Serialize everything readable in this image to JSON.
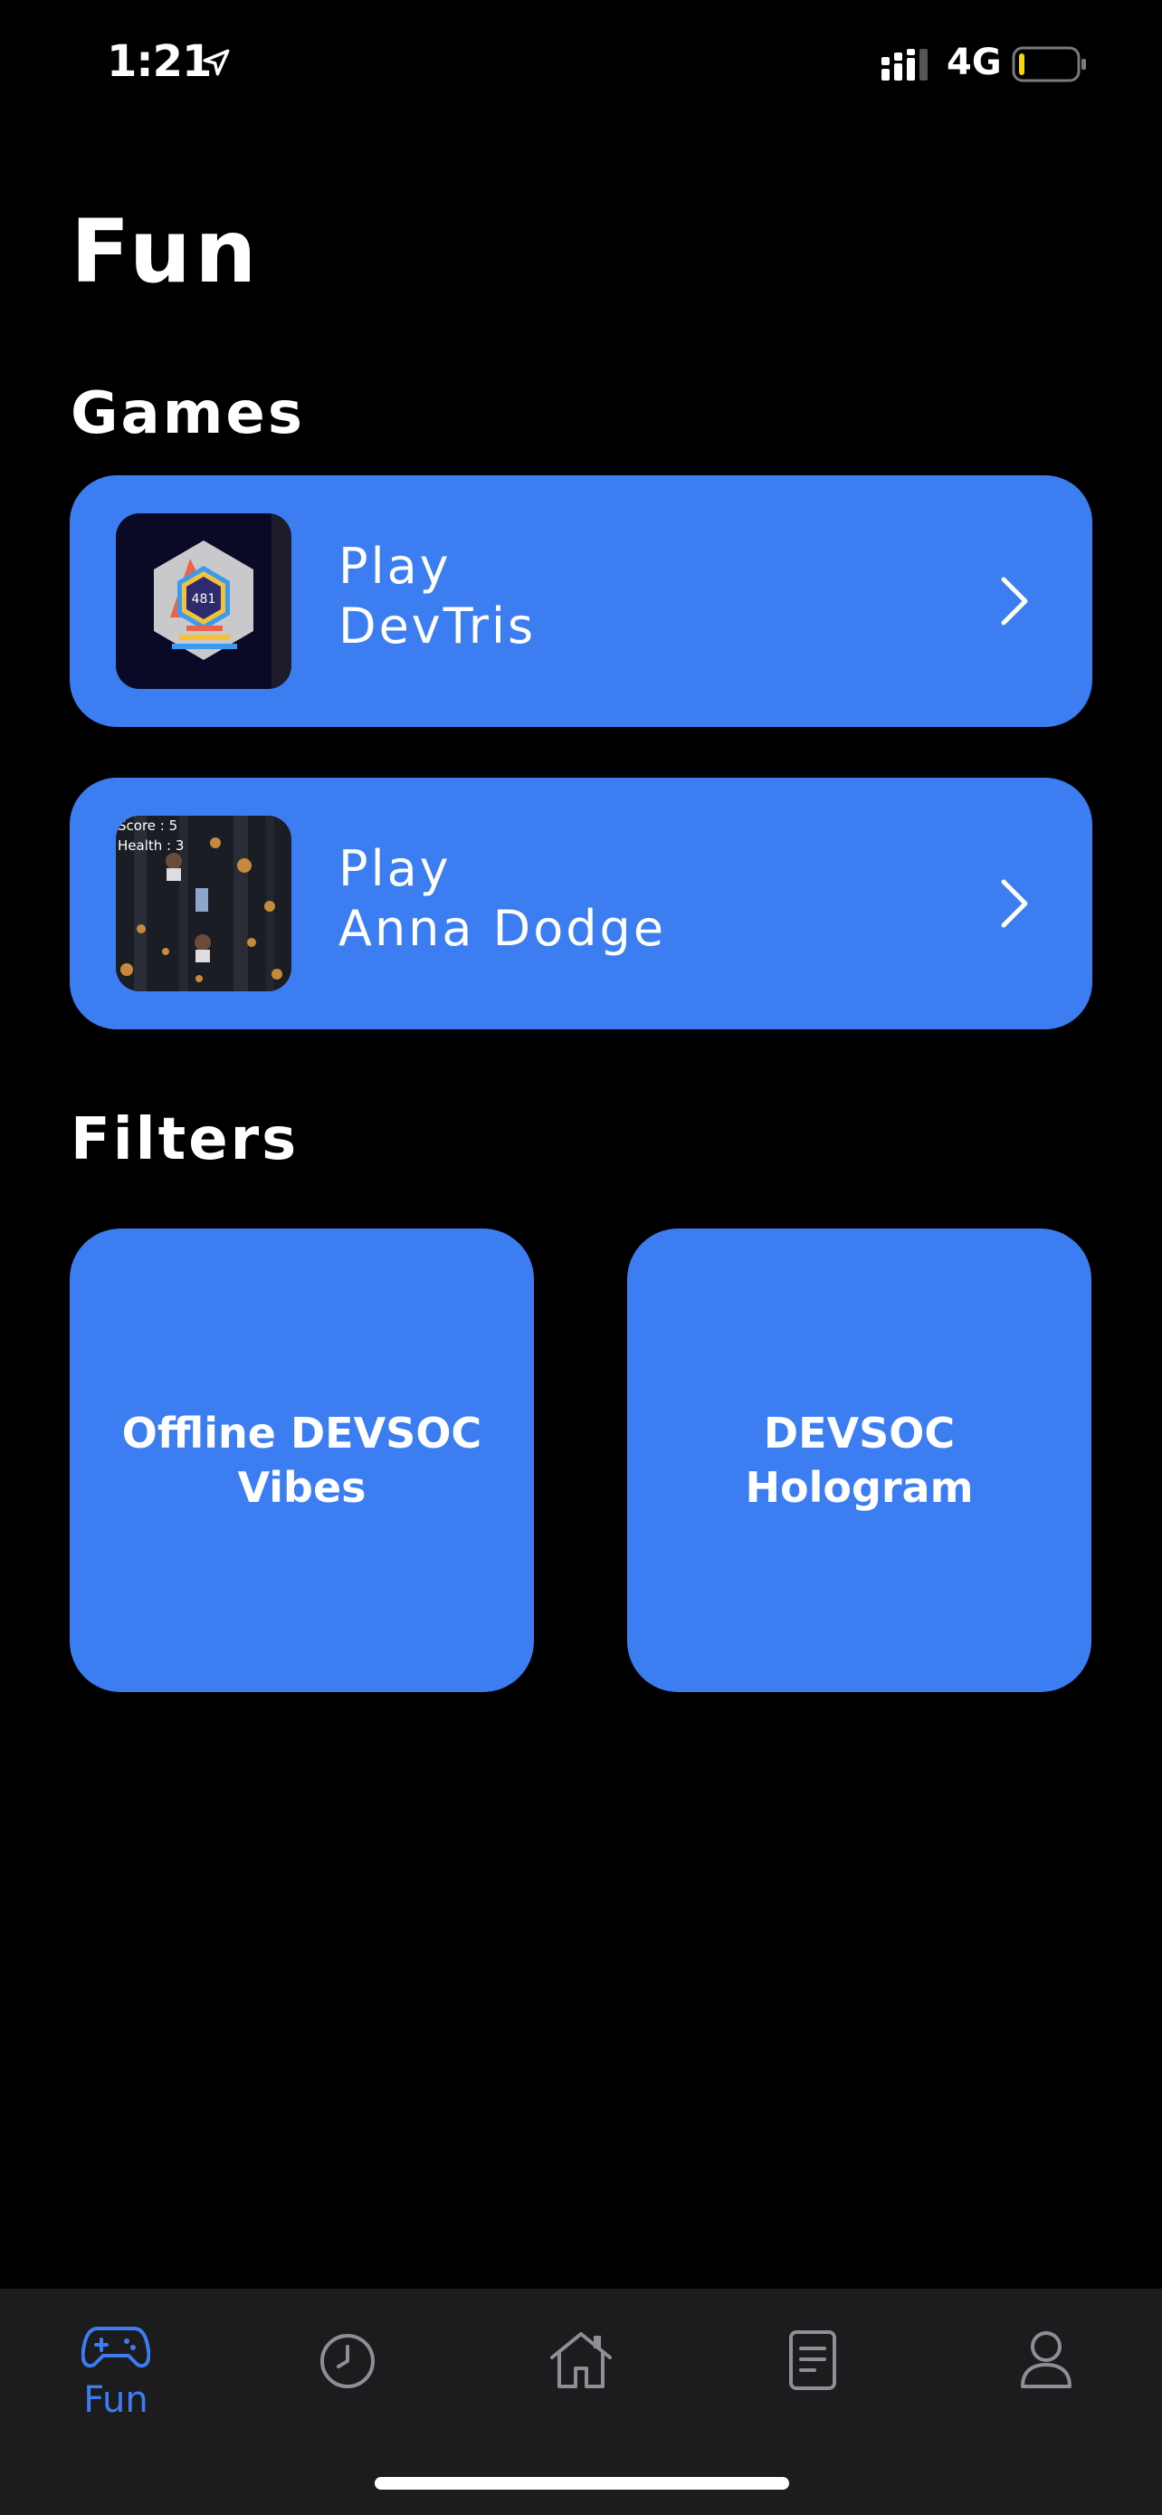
{
  "status_bar": {
    "time": "1:21",
    "network": "4G",
    "battery_color": "#f5d60a"
  },
  "page": {
    "title": "Fun"
  },
  "games_section": {
    "title": "Games",
    "items": [
      {
        "line1": "Play",
        "line2": "DevTris",
        "thumb_text": "481"
      },
      {
        "line1": "Play",
        "line2": "Anna Dodge",
        "thumb_text_1": "Score : 5",
        "thumb_text_2": "Health : 3"
      }
    ]
  },
  "filters_section": {
    "title": "Filters",
    "items": [
      {
        "label": "Offline DEVSOC Vibes"
      },
      {
        "label": "DEVSOC Hologram"
      }
    ]
  },
  "tab_bar": {
    "active_color": "#3c7ef2",
    "inactive_color": "#8e8e93",
    "items": [
      {
        "icon": "gamepad-icon",
        "label": "Fun"
      },
      {
        "icon": "clock-icon"
      },
      {
        "icon": "home-icon"
      },
      {
        "icon": "document-icon"
      },
      {
        "icon": "person-icon"
      }
    ]
  },
  "colors": {
    "card": "#3c7ef2",
    "background": "#000000"
  }
}
